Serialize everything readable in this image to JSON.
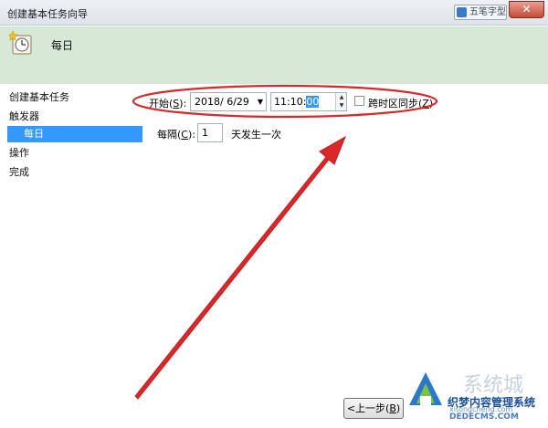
{
  "window": {
    "title": "创建基本任务向导",
    "close_label": "✕",
    "ime_label": "五笔字型"
  },
  "header": {
    "title": "每日",
    "icon": "scheduled-task-icon"
  },
  "sidebar": {
    "items": [
      {
        "label": "创建基本任务"
      },
      {
        "label": "触发器"
      },
      {
        "label": "每日"
      },
      {
        "label": "操作"
      },
      {
        "label": "完成"
      }
    ],
    "selected_index": 2
  },
  "form": {
    "start_label": "开始(",
    "start_key": "S",
    "start_label_end": "):",
    "date_value": "2018/  6/29",
    "time_prefix": "11:10:",
    "time_selected": "00",
    "sync_label_text": "跨时区同步(",
    "sync_key": "Z",
    "sync_label_end": ")",
    "sync_checked": false,
    "interval_label_text": "每隔(",
    "interval_key": "C",
    "interval_label_end": "):",
    "interval_value": "1",
    "interval_suffix": "天发生一次"
  },
  "footer": {
    "back_label": "<上一步(",
    "back_key": "B",
    "back_label_end": ")"
  },
  "watermark": {
    "brand": "系统城",
    "line": "织梦内容管理系统",
    "url": "DEDECMS.COM",
    "url2": "xitongcheng.com"
  },
  "colors": {
    "header_bg": "#d6e8d6",
    "selection": "#3399ff",
    "annotation_red": "#d8282a"
  }
}
